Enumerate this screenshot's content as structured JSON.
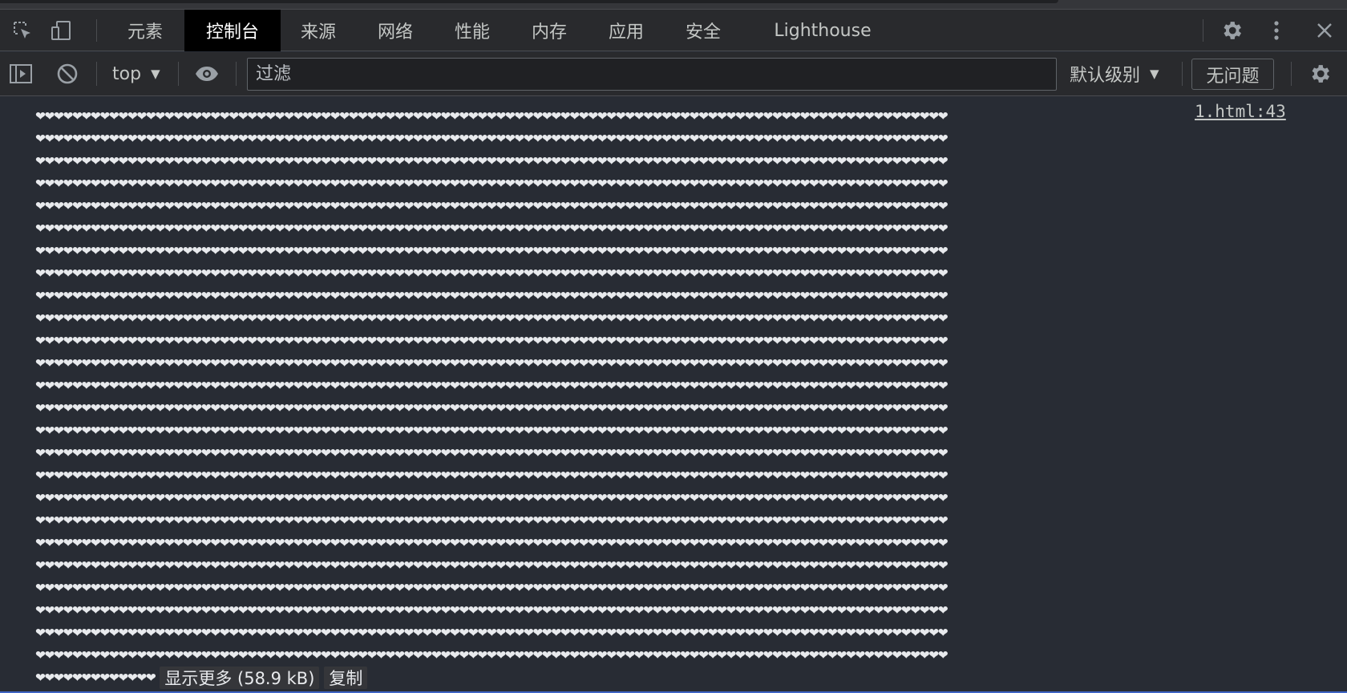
{
  "tabs": [
    {
      "label": "元素",
      "active": false
    },
    {
      "label": "控制台",
      "active": true
    },
    {
      "label": "来源",
      "active": false
    },
    {
      "label": "网络",
      "active": false
    },
    {
      "label": "性能",
      "active": false
    },
    {
      "label": "内存",
      "active": false
    },
    {
      "label": "应用",
      "active": false
    },
    {
      "label": "安全",
      "active": false
    },
    {
      "label": "Lighthouse",
      "active": false
    }
  ],
  "toolbar": {
    "context": "top",
    "filter_placeholder": "过滤",
    "levels": "默认级别",
    "issues": "无问题"
  },
  "console": {
    "source": "1.html:43",
    "heart_char": "❤",
    "full_rows": 25,
    "hearts_per_row": 99,
    "last_row_hearts": 13,
    "show_more": "显示更多 (58.9 kB)",
    "copy": "复制"
  },
  "colors": {
    "background": "#282c34",
    "toolbar": "#292a2d",
    "active_tab": "#000000",
    "text": "#e8eaed"
  }
}
